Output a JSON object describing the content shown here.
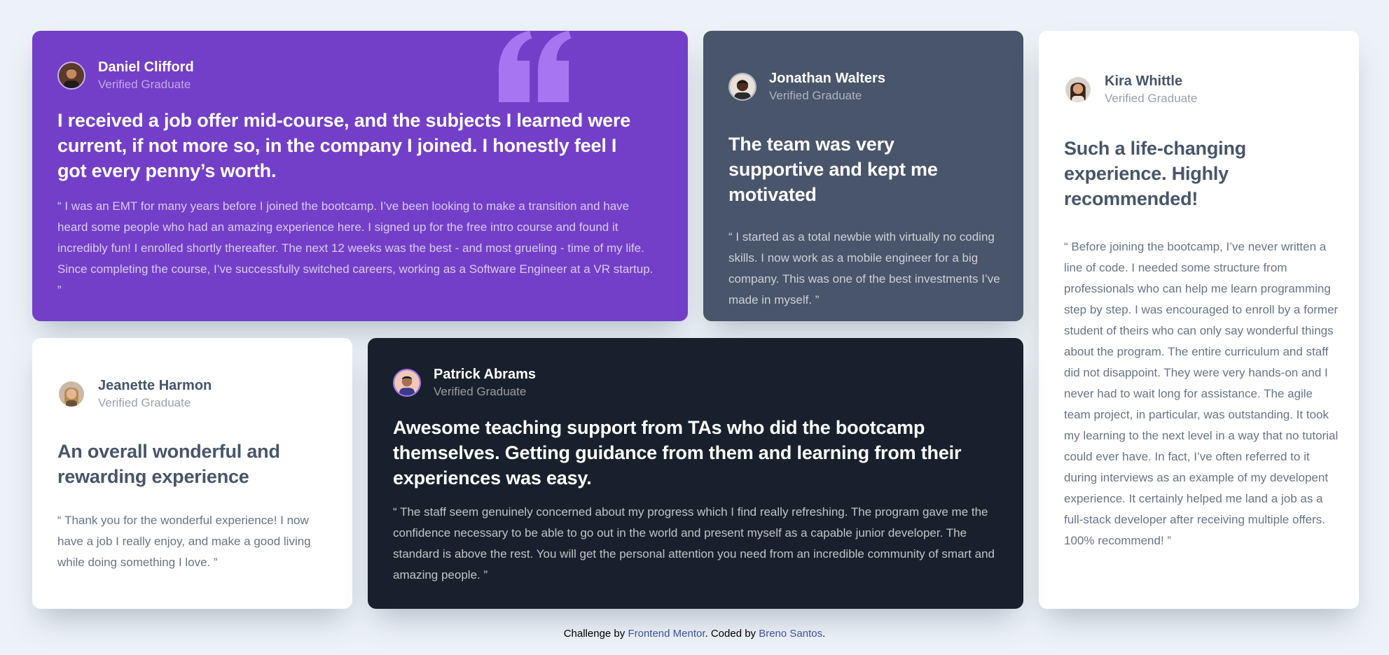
{
  "testimonials": [
    {
      "name": "Daniel Clifford",
      "role": "Verified Graduate",
      "headline": "I received a job offer mid-course, and the subjects I learned were current, if not more so, in the company I joined. I honestly feel I got every penny’s worth.",
      "quote": "“ I was an EMT for many years before I joined the bootcamp. I’ve been looking to make a transition and have heard some people who had an amazing experience here. I signed up for the free intro course and found it incredibly fun! I enrolled shortly thereafter. The next 12 weeks was the best - and most grueling - time of my life. Since completing the course, I’ve successfully switched careers, working as a Software Engineer at a VR startup. ”"
    },
    {
      "name": "Jonathan Walters",
      "role": "Verified Graduate",
      "headline": "The team was very supportive and kept me motivated",
      "quote": "“ I started as a total newbie with virtually no coding skills. I now work as a mobile engineer for a big company. This was one of the best investments I’ve made in myself. ”"
    },
    {
      "name": "Kira Whittle",
      "role": "Verified Graduate",
      "headline": "Such a life-changing experience. Highly recommended!",
      "quote": "“ Before joining the bootcamp, I’ve never written a line of code. I needed some structure from professionals who can help me learn programming step by step. I was encouraged to enroll by a former student of theirs who can only say wonderful things about the program. The entire curriculum and staff did not disappoint. They were very hands-on and I never had to wait long for assistance. The agile team project, in particular, was outstanding. It took my learning to the next level in a way that no tutorial could ever have. In fact, I’ve often referred to it during interviews as an example of my developent experience. It certainly helped me land a job as a full-stack developer after receiving multiple offers. 100% recommend! ”"
    },
    {
      "name": "Jeanette Harmon",
      "role": "Verified Graduate",
      "headline": "An overall wonderful and rewarding experience",
      "quote": "“ Thank you for the wonderful experience! I now have a job I really enjoy, and make a good living while doing something I love. ”"
    },
    {
      "name": "Patrick Abrams",
      "role": "Verified Graduate",
      "headline": "Awesome teaching support from TAs who did the bootcamp themselves. Getting guidance from them and learning from their experiences was easy.",
      "quote": "“ The staff seem genuinely concerned about my progress which I find really refreshing. The program gave me the confidence necessary to be able to go out in the world and present myself as a capable junior developer. The standard is above the rest. You will get the personal attention you need from an incredible community of smart and amazing people. ”"
    }
  ],
  "attribution": {
    "prefix": "Challenge by",
    "link1": "Frontend Mentor",
    "middle": ". Coded by",
    "link2": "Breno Santos",
    "suffix": "."
  },
  "icons": {
    "quote": "quote-mark-icon"
  },
  "colors": {
    "purple": "#733fc8",
    "gray": "#48556a",
    "dark": "#19202d",
    "white": "#ffffff",
    "background": "#ecf2f8"
  }
}
